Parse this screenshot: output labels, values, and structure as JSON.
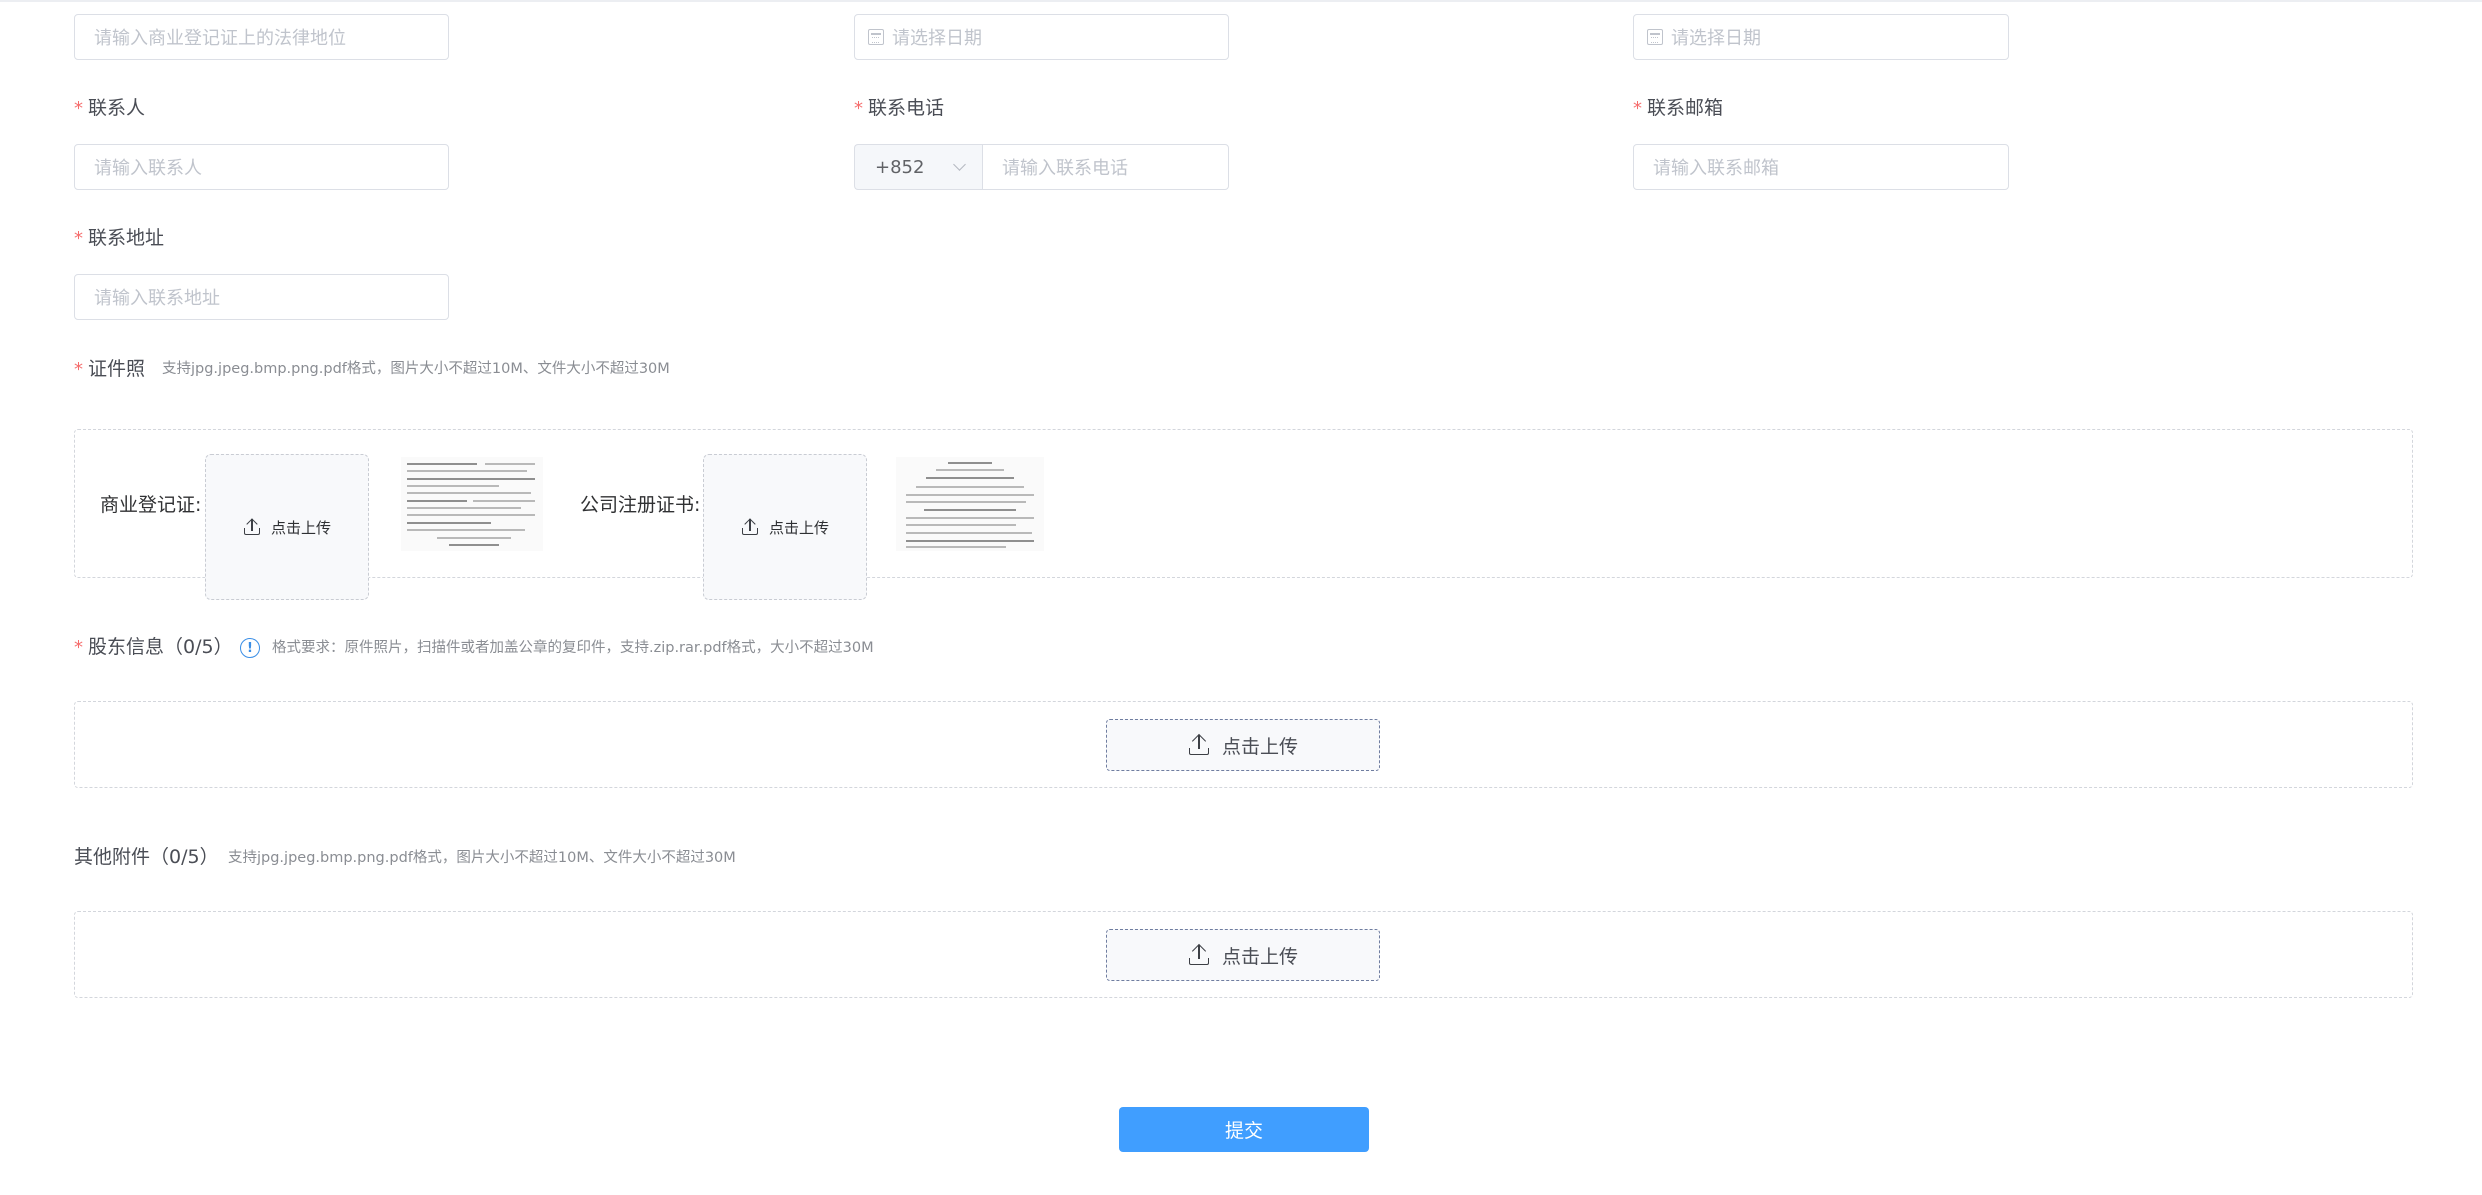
{
  "form": {
    "legal_status": {
      "placeholder": "请输入商业登记证上的法律地位"
    },
    "date_1": {
      "placeholder": "请选择日期"
    },
    "date_2": {
      "placeholder": "请选择日期"
    },
    "contact_person": {
      "required_mark": "*",
      "label": "联系人",
      "placeholder": "请输入联系人"
    },
    "contact_phone": {
      "required_mark": "*",
      "label": "联系电话",
      "prefix_value": "+852",
      "placeholder": "请输入联系电话"
    },
    "contact_email": {
      "required_mark": "*",
      "label": "联系邮箱",
      "placeholder": "请输入联系邮箱"
    },
    "contact_address": {
      "required_mark": "*",
      "label": "联系地址",
      "placeholder": "请输入联系地址"
    }
  },
  "certificates": {
    "required_mark": "*",
    "label": "证件照",
    "hint": "支持jpg.jpeg.bmp.png.pdf格式，图片大小不超过10M、文件大小不超过30M",
    "items": [
      {
        "label": "商业登记证:",
        "upload_label": "点击上传"
      },
      {
        "label": "公司注册证书:",
        "upload_label": "点击上传"
      }
    ]
  },
  "shareholders": {
    "required_mark": "*",
    "label": "股东信息（0/5）",
    "hint": "格式要求：原件照片，扫描件或者加盖公章的复印件，支持.zip.rar.pdf格式，大小不超过30M",
    "upload_label": "点击上传",
    "info_icon": "info-circle-icon"
  },
  "attachments": {
    "label": "其他附件（0/5）",
    "hint": "支持jpg.jpeg.bmp.png.pdf格式，图片大小不超过10M、文件大小不超过30M",
    "upload_label": "点击上传"
  },
  "submit": {
    "label": "提交"
  },
  "colors": {
    "primary": "#409eff",
    "required": "#f56c6c",
    "border": "#dcdfe6",
    "placeholder": "#c0c4cc"
  }
}
